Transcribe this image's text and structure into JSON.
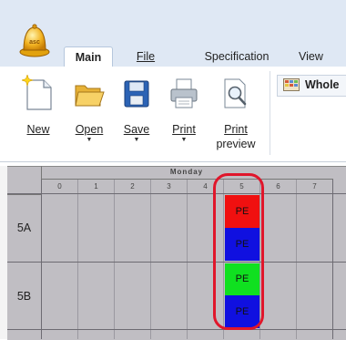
{
  "tabs": [
    {
      "label": "Main",
      "active": true
    },
    {
      "label": "File",
      "active": false
    },
    {
      "label": "Specification",
      "active": false
    },
    {
      "label": "View",
      "active": false
    }
  ],
  "ribbon": {
    "buttons": [
      {
        "label": "New",
        "icon": "new-document-icon",
        "dropdown": false
      },
      {
        "label": "Open",
        "icon": "folder-open-icon",
        "dropdown": true
      },
      {
        "label": "Save",
        "icon": "floppy-disk-icon",
        "dropdown": true
      },
      {
        "label": "Print",
        "icon": "printer-icon",
        "dropdown": true
      },
      {
        "label_line1": "Print",
        "label_line2": "preview",
        "icon": "print-preview-icon",
        "dropdown": false
      }
    ],
    "whole_label": "Whole"
  },
  "timetable": {
    "day": "Monday",
    "periods": [
      "0",
      "1",
      "2",
      "3",
      "4",
      "5",
      "6",
      "7"
    ],
    "classes": [
      {
        "name": "5A",
        "lessons": [
          {
            "period": "5",
            "label": "PE",
            "color": "#f01010"
          },
          {
            "period": "5",
            "label": "PE",
            "color": "#1010e0"
          }
        ]
      },
      {
        "name": "5B",
        "lessons": [
          {
            "period": "5",
            "label": "PE",
            "color": "#10e020"
          },
          {
            "period": "5",
            "label": "PE",
            "color": "#1010e0"
          }
        ]
      }
    ]
  },
  "colors": {
    "accent_highlight": "#e0162b",
    "grid_bg": "#c0bec3"
  }
}
